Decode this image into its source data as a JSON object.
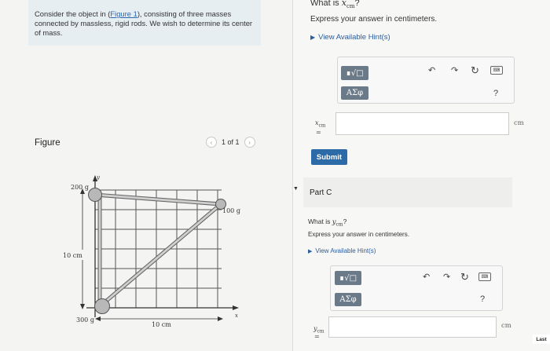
{
  "problem": {
    "text_before": "Consider the object in (",
    "figure_link": "Figure 1",
    "text_after": "), consisting of three masses connected by massless, rigid rods. We wish to determine its center of mass."
  },
  "figure": {
    "label": "Figure",
    "pager": "1 of 1",
    "prev": "‹",
    "next": "›",
    "mass_top_left": "200 g",
    "mass_right": "100 g",
    "mass_bottom_left": "300 g",
    "y_scale": "10 cm",
    "x_scale": "10 cm",
    "x_axis": "x",
    "y_axis": "y"
  },
  "part_b": {
    "question_prefix": "What is ",
    "var": "x",
    "var_sub": "cm",
    "question_suffix": "?",
    "instruction": "Express your answer in centimeters.",
    "hints": "View Available Hint(s)",
    "math_btn": "∎√□",
    "greek_btn": "ΑΣφ",
    "help": "?",
    "eq": "=",
    "unit": "cm",
    "submit": "Submit"
  },
  "part_c": {
    "label": "Part C",
    "question_prefix": "What is ",
    "var": "y",
    "var_sub": "cm",
    "question_suffix": "?",
    "instruction": "Express your answer in centimeters.",
    "hints": "View Available Hint(s)",
    "math_btn": "∎√□",
    "greek_btn": "ΑΣφ",
    "help": "?",
    "eq": "=",
    "unit": "cm"
  },
  "footer": {
    "last": "Last"
  }
}
